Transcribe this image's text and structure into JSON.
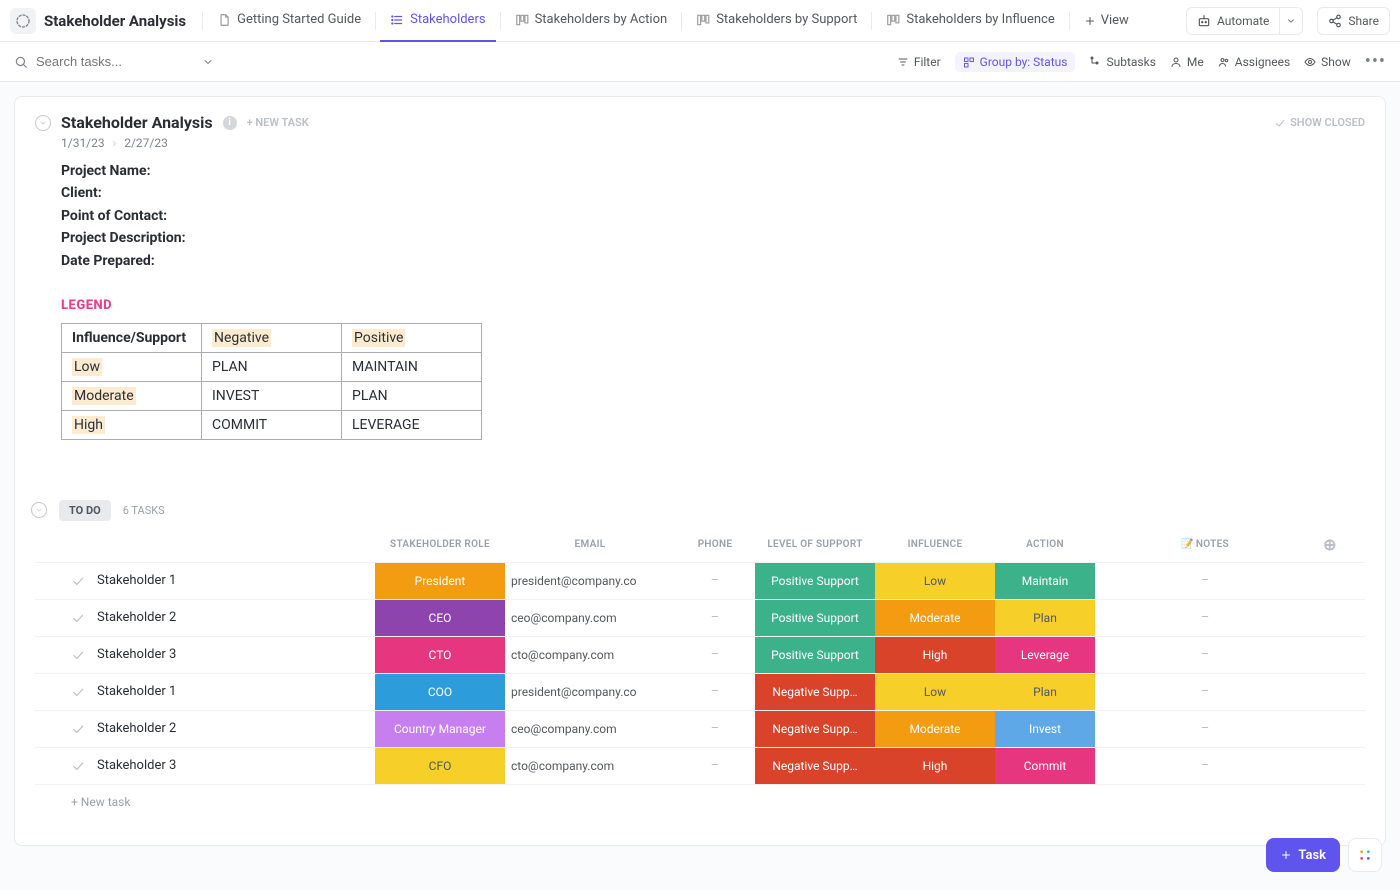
{
  "header": {
    "space_title": "Stakeholder Analysis",
    "tabs": [
      {
        "label": "Getting Started Guide"
      },
      {
        "label": "Stakeholders"
      },
      {
        "label": "Stakeholders by Action"
      },
      {
        "label": "Stakeholders by Support"
      },
      {
        "label": "Stakeholders by Influence"
      }
    ],
    "add_view": "View",
    "automate": "Automate",
    "share": "Share"
  },
  "toolbar": {
    "search_placeholder": "Search tasks...",
    "filter": "Filter",
    "groupby": "Group by: Status",
    "subtasks": "Subtasks",
    "me": "Me",
    "assignees": "Assignees",
    "show": "Show"
  },
  "list": {
    "title": "Stakeholder Analysis",
    "new_task": "+ NEW TASK",
    "show_closed": "SHOW CLOSED",
    "date_start": "1/31/23",
    "date_end": "2/27/23",
    "fields": {
      "project_name": "Project Name:",
      "client": "Client:",
      "poc": "Point of Contact:",
      "desc": "Project Description:",
      "prepared": "Date Prepared:"
    },
    "legend_heading": "LEGEND",
    "legend": {
      "h_corner": "Influence/Support",
      "h_neg": "Negative",
      "h_pos": "Positive",
      "rows": [
        {
          "k": "Low",
          "neg": "PLAN",
          "pos": "MAINTAIN"
        },
        {
          "k": "Moderate",
          "neg": "INVEST",
          "pos": "PLAN"
        },
        {
          "k": "High",
          "neg": "COMMIT",
          "pos": "LEVERAGE"
        }
      ]
    }
  },
  "table": {
    "status_name": "TO DO",
    "task_count": "6 TASKS",
    "columns": {
      "role": "STAKEHOLDER ROLE",
      "email": "EMAIL",
      "phone": "PHONE",
      "support": "LEVEL OF SUPPORT",
      "influence": "INFLUENCE",
      "action": "ACTION",
      "notes": "NOTES"
    },
    "rows": [
      {
        "name": "Stakeholder 1",
        "role": "President",
        "role_c": "#f39c12",
        "email": "president@company.co",
        "phone": "–",
        "support": "Positive Support",
        "support_c": "#3cb28b",
        "influence": "Low",
        "influence_c": "#f6d029",
        "influence_dark": true,
        "action": "Maintain",
        "action_c": "#3cb28b",
        "notes": "–"
      },
      {
        "name": "Stakeholder 2",
        "role": "CEO",
        "role_c": "#8e44ad",
        "email": "ceo@company.com",
        "phone": "–",
        "support": "Positive Support",
        "support_c": "#3cb28b",
        "influence": "Moderate",
        "influence_c": "#f39c12",
        "action": "Plan",
        "action_c": "#f6d029",
        "action_dark": true,
        "notes": "–"
      },
      {
        "name": "Stakeholder 3",
        "role": "CTO",
        "role_c": "#e6367f",
        "email": "cto@company.com",
        "phone": "–",
        "support": "Positive Support",
        "support_c": "#3cb28b",
        "influence": "High",
        "influence_c": "#d9432a",
        "action": "Leverage",
        "action_c": "#e6367f",
        "notes": "–"
      },
      {
        "name": "Stakeholder 1",
        "role": "COO",
        "role_c": "#2d9cdb",
        "email": "president@company.co",
        "phone": "–",
        "support": "Negative Supp…",
        "support_c": "#d9432a",
        "influence": "Low",
        "influence_c": "#f6d029",
        "influence_dark": true,
        "action": "Plan",
        "action_c": "#f6d029",
        "action_dark": true,
        "notes": "–"
      },
      {
        "name": "Stakeholder 2",
        "role": "Country Manager",
        "role_c": "#c77ff0",
        "email": "ceo@company.com",
        "phone": "–",
        "support": "Negative Supp…",
        "support_c": "#d9432a",
        "influence": "Moderate",
        "influence_c": "#f39c12",
        "action": "Invest",
        "action_c": "#5fa8e8",
        "notes": "–"
      },
      {
        "name": "Stakeholder 3",
        "role": "CFO",
        "role_c": "#f6d029",
        "role_dark": true,
        "email": "cto@company.com",
        "phone": "–",
        "support": "Negative Supp…",
        "support_c": "#d9432a",
        "influence": "High",
        "influence_c": "#d9432a",
        "action": "Commit",
        "action_c": "#e6367f",
        "notes": "–"
      }
    ],
    "new_task_row": "+ New task"
  },
  "floating": {
    "task": "Task"
  }
}
